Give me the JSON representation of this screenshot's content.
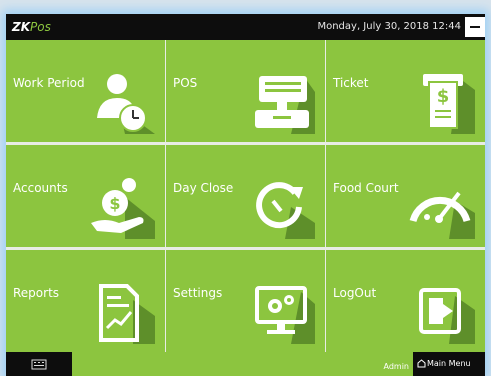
{
  "header": {
    "logo_primary": "ZK",
    "logo_secondary": "Pos",
    "datetime": "Monday, July 30, 2018 12:44"
  },
  "tiles": [
    {
      "label": "Work Period",
      "icon": "work-period-icon"
    },
    {
      "label": "POS",
      "icon": "pos-terminal-icon"
    },
    {
      "label": "Ticket",
      "icon": "ticket-icon"
    },
    {
      "label": "Accounts",
      "icon": "accounts-icon"
    },
    {
      "label": "Day Close",
      "icon": "day-close-icon"
    },
    {
      "label": "Food Court",
      "icon": "gauge-icon"
    },
    {
      "label": "Reports",
      "icon": "report-icon"
    },
    {
      "label": "Settings",
      "icon": "settings-icon"
    },
    {
      "label": "LogOut",
      "icon": "logout-icon"
    }
  ],
  "footer": {
    "user": "Admin",
    "main_menu": "Main Menu"
  },
  "colors": {
    "tile_green": "#8cc53f",
    "bar_dark": "#0d0d0d",
    "glow": "#9fd0f5"
  }
}
